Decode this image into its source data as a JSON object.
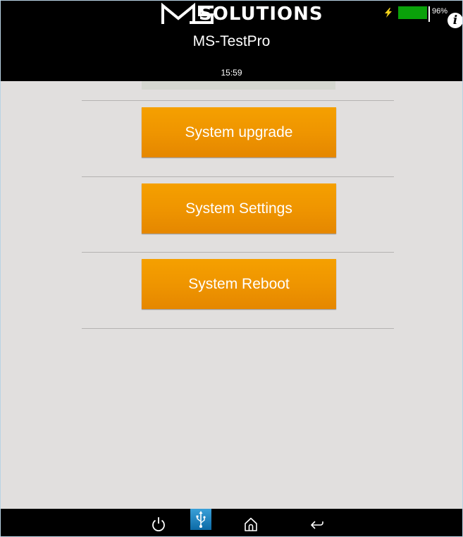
{
  "header": {
    "logo_text": "SOLUTIONS",
    "app_title": "MS-TestPro",
    "clock": "15:59"
  },
  "status": {
    "battery_percent_label": "96%",
    "battery_level": 0.96,
    "battery_color": "#0aa10a",
    "charging_icon": "lightning-bolt-icon",
    "info_icon_glyph": "i"
  },
  "menu": {
    "items": [
      {
        "label": "System upgrade"
      },
      {
        "label": "System Settings"
      },
      {
        "label": "System Reboot"
      }
    ],
    "button_color": "#ef9500"
  },
  "navbar": {
    "icons": [
      "power-icon",
      "usb-icon",
      "home-icon",
      "back-icon"
    ]
  },
  "colors": {
    "header_bg": "#000000",
    "content_bg": "#e1dfde",
    "accent_orange": "#ef9500"
  }
}
